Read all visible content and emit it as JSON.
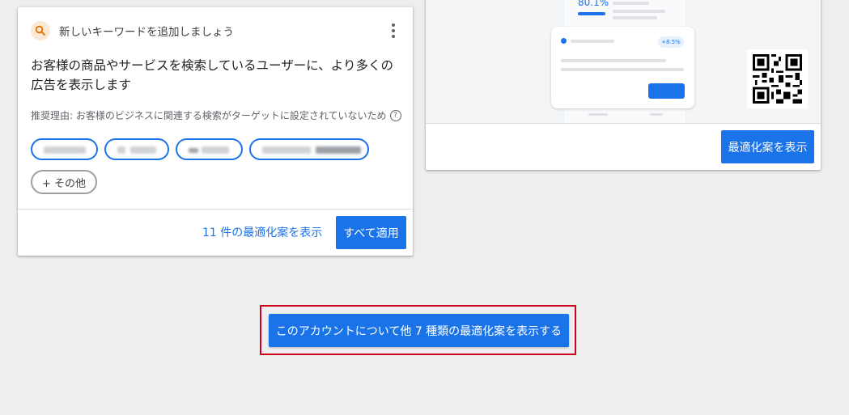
{
  "keyword_card": {
    "title": "新しいキーワードを追加しましょう",
    "description": "お客様の商品やサービスを検索しているユーザーに、より多くの広告を表示します",
    "reason": "推奨理由: お客様のビジネスに関連する検索がターゲットに設定されていないため",
    "help_glyph": "?",
    "more_chip": "+ その他",
    "view_link": "11 件の最適化案を表示",
    "apply_button": "すべて適用",
    "icon": "search-icon",
    "menu_icon": "more-vert-icon"
  },
  "preview_card": {
    "illustration_percent": "80.1%",
    "illustration_badge": "+8.5%",
    "button": "最適化案を表示"
  },
  "footer": {
    "more_button": "このアカウントについて他 7 種類の最適化案を表示する"
  },
  "colors": {
    "accent": "#1a73e8",
    "highlight_border": "#d0021b",
    "background": "#eeeeee"
  }
}
